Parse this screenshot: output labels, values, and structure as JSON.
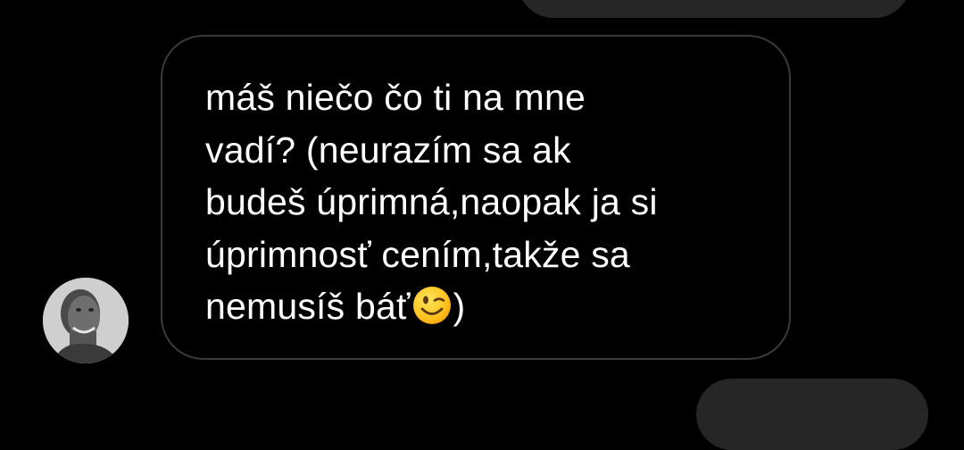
{
  "conversation": {
    "message": {
      "lines": [
        "máš niečo čo ti na mne",
        "vadí? (neurazím sa ak",
        "budeš úprimná,naopak ja si",
        "úprimnosť cením,takže sa"
      ],
      "last_line_before_emoji": "nemusíš báť",
      "emoji_name": "winking-face-emoji",
      "last_line_after_emoji": ")"
    },
    "sender": {
      "avatar_icon": "avatar-profile-photo"
    },
    "colors": {
      "background": "#000000",
      "bubble_border": "#3a3a3a",
      "other_bubble": "#262626",
      "text": "#ffffff"
    }
  }
}
